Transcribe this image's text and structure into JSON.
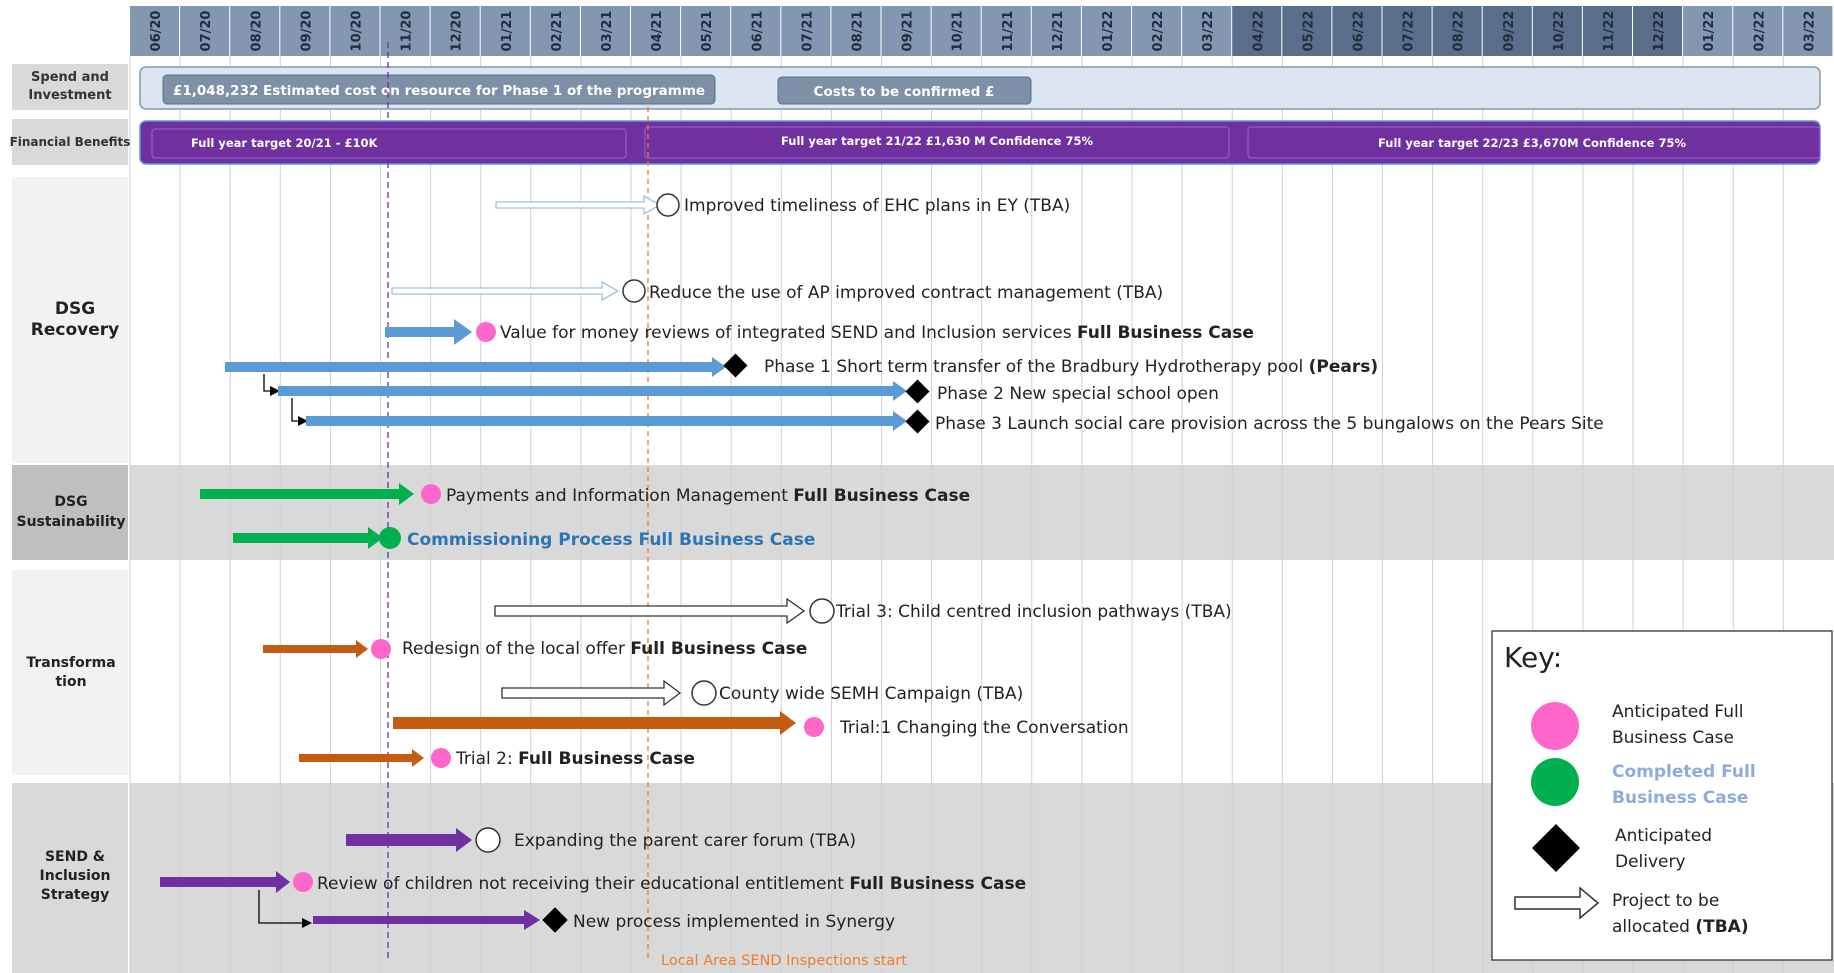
{
  "months": [
    "06/20",
    "07/20",
    "08/20",
    "09/20",
    "10/20",
    "11/20",
    "12/20",
    "01/21",
    "02/21",
    "03/21",
    "04/21",
    "05/21",
    "06/21",
    "07/21",
    "08/21",
    "09/21",
    "10/21",
    "11/21",
    "12/21",
    "01/22",
    "02/22",
    "03/22",
    "04/22",
    "05/22",
    "06/22",
    "07/22",
    "08/22",
    "09/22",
    "10/22",
    "11/22",
    "12/22",
    "01/22",
    "02/22",
    "03/22"
  ],
  "sections": {
    "spend": "Spend and Investment",
    "benefits": "Financial Benefits",
    "dsg_recovery": "DSG Recovery",
    "dsg_sustainability": "DSG Sustainability",
    "transformation": "Transformation",
    "send": "SEND & Inclusion Strategy"
  },
  "spend_bars": [
    "£1,048,232 Estimated cost on resource for Phase 1 of the programme",
    "Costs to be confirmed £"
  ],
  "benefit_bars": [
    "Full year target  20/21  - £10K",
    "Full year target 21/22  £1,630 M Confidence 75%",
    "Full year  target 22/23 £3,670M Confidence 75%"
  ],
  "items": [
    {
      "pre": "Improved timeliness of EHC plans in EY (TBA)",
      "bold": ""
    },
    {
      "pre": "Reduce the use of AP improved contract management (TBA)",
      "bold": ""
    },
    {
      "pre": "Value for money reviews of integrated SEND and Inclusion services ",
      "bold": "Full Business Case"
    },
    {
      "pre": "Phase 1 Short term transfer of the Bradbury Hydrotherapy pool ",
      "bold": "(Pears)"
    },
    {
      "pre": "Phase 2 New special school open",
      "bold": ""
    },
    {
      "pre": "Phase 3 Launch social care provision across the 5 bungalows on the Pears Site",
      "bold": ""
    },
    {
      "pre": "Payments and Information Management ",
      "bold": "Full Business Case"
    },
    {
      "pre": "Commissioning Process Full Business Case",
      "bold": ""
    },
    {
      "pre": "Trial 3: Child centred inclusion pathways (TBA)",
      "bold": ""
    },
    {
      "pre": "Redesign of the local offer ",
      "bold": "Full Business Case"
    },
    {
      "pre": "County wide SEMH Campaign (TBA)",
      "bold": ""
    },
    {
      "pre": "Trial:1 Changing the Conversation",
      "bold": ""
    },
    {
      "pre": "Trial 2: ",
      "bold": "Full Business Case"
    },
    {
      "pre": "Expanding the parent carer forum (TBA)",
      "bold": ""
    },
    {
      "pre": "Review of children not receiving their educational entitlement ",
      "bold": "Full Business Case"
    },
    {
      "pre": "New process implemented in Synergy",
      "bold": ""
    }
  ],
  "inspection_label": "Local Area SEND Inspections start",
  "key": {
    "title": "Key:",
    "anticipated_fbc": "Anticipated Full Business Case",
    "completed_fbc": "Completed Full Business Case",
    "anticipated_delivery": "Anticipated Delivery",
    "tba_pre": "Project to be allocated ",
    "tba_bold": "(TBA)"
  },
  "colors": {
    "blue": "#5b9bd5",
    "green": "#00b050",
    "orange": "#c55a11",
    "purple": "#7030a0",
    "pink": "#ff66cc",
    "header": "#8497b0",
    "header_dark": "#5a6f8c",
    "bar_label": "#7f8fa8",
    "inspection": "#ed7d31"
  }
}
